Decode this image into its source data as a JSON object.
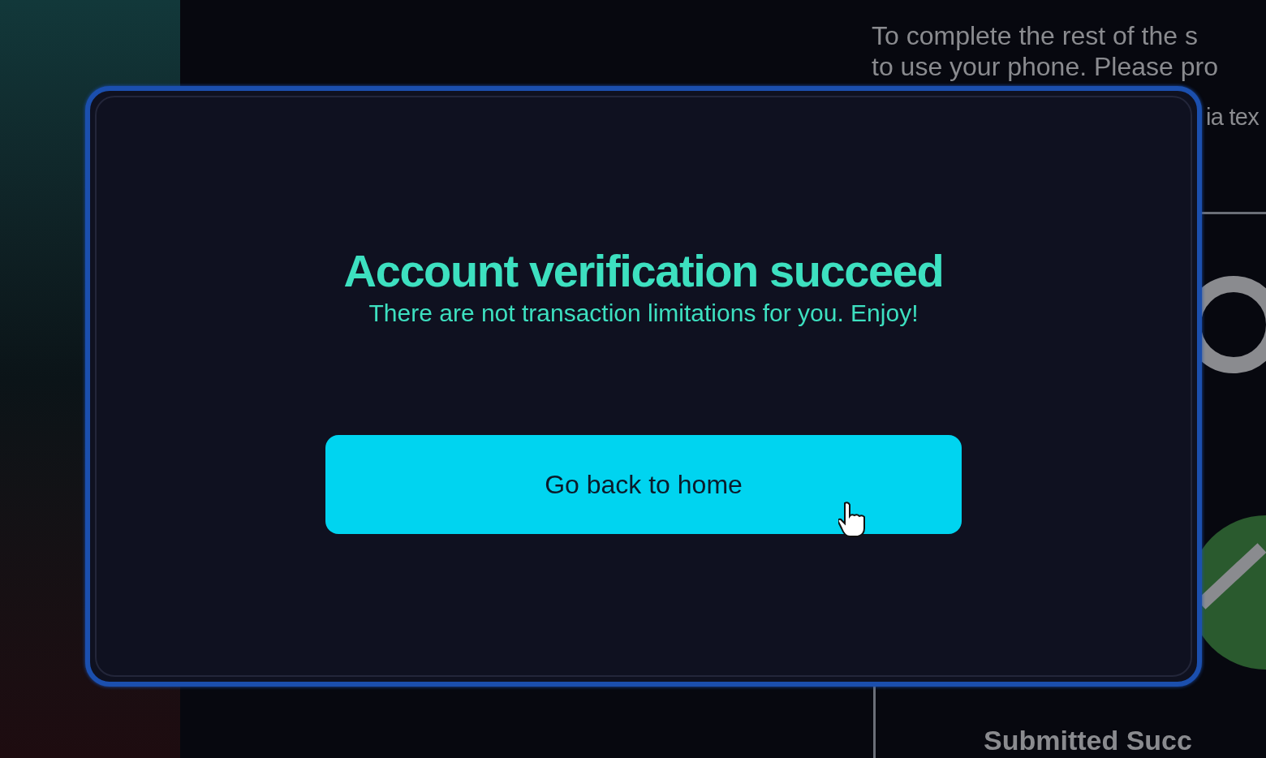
{
  "background_page": {
    "instruction_lines": [
      "To complete the rest of the s",
      "to use your phone. Please pro",
      "ia tex"
    ],
    "step_label": "Submitted Succ"
  },
  "dialog": {
    "title": "Account verification succeed",
    "message": "There are not transaction limitations for you. Enjoy!",
    "button": "Go back to home"
  }
}
